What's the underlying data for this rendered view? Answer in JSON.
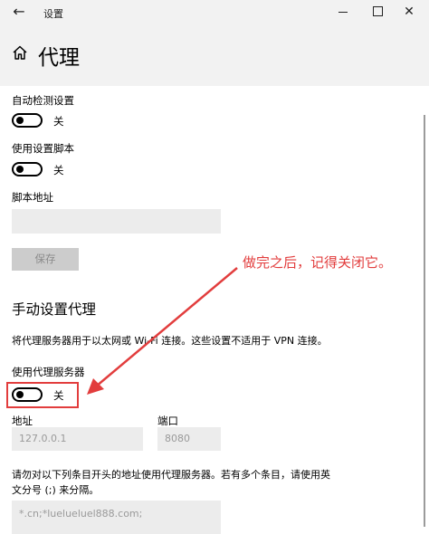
{
  "window": {
    "title": "设置",
    "back_glyph": "←",
    "minimize_label": "",
    "maximize_label": "",
    "close_glyph": "✕"
  },
  "page": {
    "title": "代理"
  },
  "auto": {
    "detect_label": "自动检测设置",
    "detect_state": "关",
    "script_label": "使用设置脚本",
    "script_state": "关",
    "script_address_label": "脚本地址",
    "script_address_value": "",
    "save_label": "保存"
  },
  "manual": {
    "section_title": "手动设置代理",
    "description": "将代理服务器用于以太网或 Wi-Fi 连接。这些设置不适用于 VPN 连接。",
    "use_proxy_label": "使用代理服务器",
    "use_proxy_state": "关",
    "address_label": "地址",
    "address_value": "127.0.0.1",
    "port_label": "端口",
    "port_value": "8080",
    "exceptions_desc_line1": "请勿对以下列条目开头的地址使用代理服务器。若有多个条目，请使用英",
    "exceptions_desc_line2": "文分号 (;) 来分隔。",
    "exceptions_value": "*.cn;*luelueluel888.com;"
  },
  "annotation": {
    "text": "做完之后，记得关闭它。",
    "color": "#e23d3d"
  },
  "icons": {
    "back": "back-arrow-icon",
    "home": "home-icon",
    "minimize": "minimize-icon",
    "maximize": "maximize-icon",
    "close": "close-icon"
  }
}
